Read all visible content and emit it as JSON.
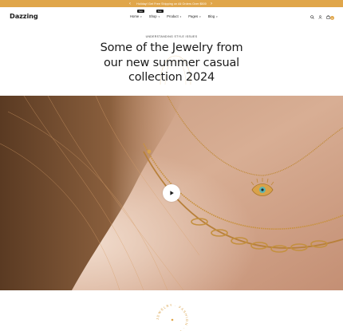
{
  "topbar": {
    "announcement": "Holiday! Get Free Shipping on All Orders Over $500",
    "prev_icon": "chevron-left-icon",
    "next_icon": "chevron-right-icon"
  },
  "header": {
    "logo": "Dazzing",
    "nav": [
      {
        "label": "Home",
        "badge": "New"
      },
      {
        "label": "Shop",
        "badge": "Sale"
      },
      {
        "label": "Product",
        "badge": ""
      },
      {
        "label": "Pages",
        "badge": ""
      },
      {
        "label": "Blog",
        "badge": ""
      }
    ],
    "icons": [
      "search-icon",
      "user-icon",
      "shopping-bag-icon"
    ],
    "cart_count": "0"
  },
  "hero": {
    "eyebrow": "UNDERSTANDING STYLE ISSUES",
    "headline_lines": [
      "Some of the Jewelry from",
      "our new summer casual",
      "collection 2024"
    ]
  },
  "media": {
    "play_icon": "play-icon"
  },
  "seal": {
    "text": "JEWELRY · FASHION · STYLE · "
  },
  "colors": {
    "accent": "#e0a64a",
    "text": "#1b1b1b",
    "background": "#ffffff"
  }
}
